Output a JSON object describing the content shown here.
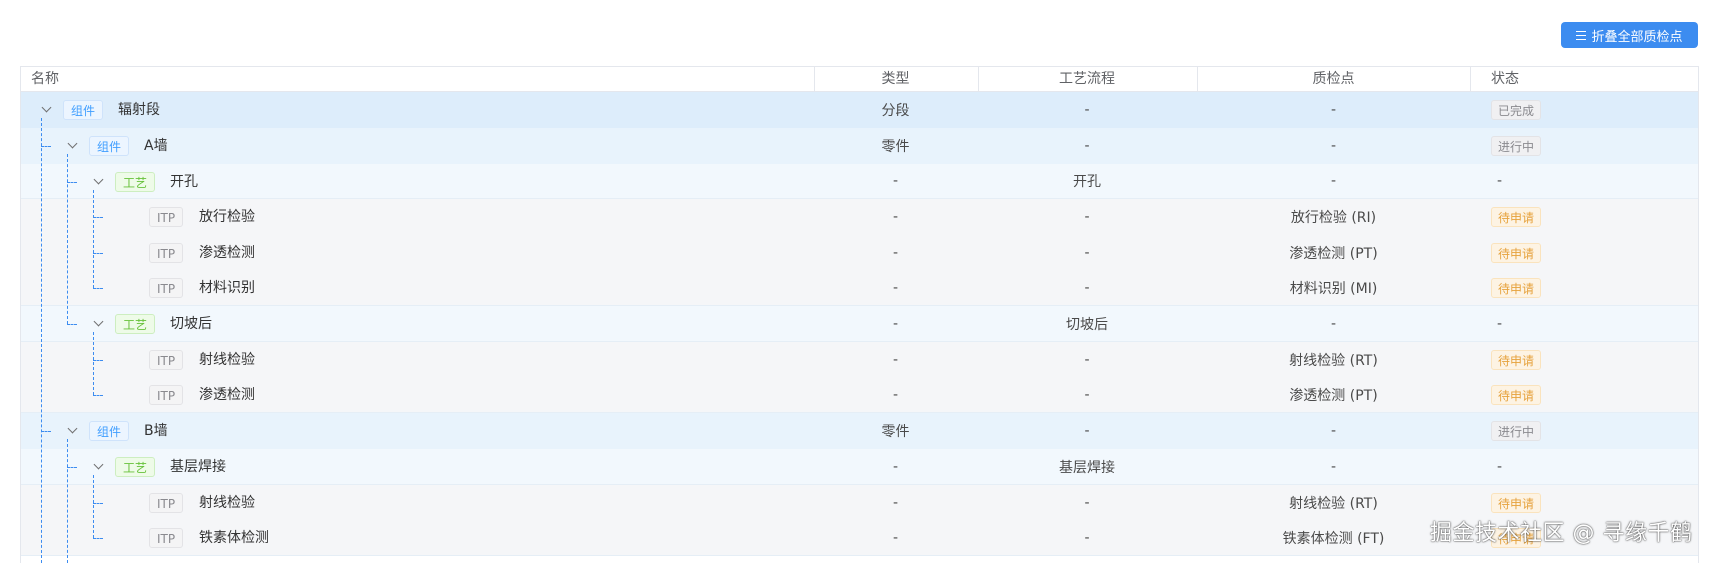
{
  "toolbar": {
    "collapse_label": "折叠全部质检点",
    "collapse_icon": "list-icon"
  },
  "columns": {
    "name": "名称",
    "type": "类型",
    "process": "工艺流程",
    "qc": "质检点",
    "status": "状态"
  },
  "colors": {
    "accent": "#3c8cf0",
    "pending": "#e6a23c",
    "component_tag": "#409eff",
    "process_tag": "#67c23a"
  },
  "rows": [
    {
      "level": 0,
      "tag": "组件",
      "name": "辐射段",
      "type": "分段",
      "process": "-",
      "qc": "-",
      "status": "已完成"
    },
    {
      "level": 1,
      "tag": "组件",
      "name": "A墙",
      "type": "零件",
      "process": "-",
      "qc": "-",
      "status": "进行中"
    },
    {
      "level": 2,
      "tag": "工艺",
      "name": "开孔",
      "type": "-",
      "process": "开孔",
      "qc": "-",
      "status": "-"
    },
    {
      "level": 3,
      "tag": "ITP",
      "name": "放行检验",
      "type": "-",
      "process": "-",
      "qc": "放行检验 (RI)",
      "status": "待申请"
    },
    {
      "level": 3,
      "tag": "ITP",
      "name": "渗透检测",
      "type": "-",
      "process": "-",
      "qc": "渗透检测 (PT)",
      "status": "待申请"
    },
    {
      "level": 3,
      "tag": "ITP",
      "name": "材料识别",
      "type": "-",
      "process": "-",
      "qc": "材料识别 (MI)",
      "status": "待申请"
    },
    {
      "level": 2,
      "tag": "工艺",
      "name": "切坡后",
      "type": "-",
      "process": "切坡后",
      "qc": "-",
      "status": "-"
    },
    {
      "level": 3,
      "tag": "ITP",
      "name": "射线检验",
      "type": "-",
      "process": "-",
      "qc": "射线检验 (RT)",
      "status": "待申请"
    },
    {
      "level": 3,
      "tag": "ITP",
      "name": "渗透检测",
      "type": "-",
      "process": "-",
      "qc": "渗透检测 (PT)",
      "status": "待申请"
    },
    {
      "level": 1,
      "tag": "组件",
      "name": "B墙",
      "type": "零件",
      "process": "-",
      "qc": "-",
      "status": "进行中"
    },
    {
      "level": 2,
      "tag": "工艺",
      "name": "基层焊接",
      "type": "-",
      "process": "基层焊接",
      "qc": "-",
      "status": "-"
    },
    {
      "level": 3,
      "tag": "ITP",
      "name": "射线检验",
      "type": "-",
      "process": "-",
      "qc": "射线检验 (RT)",
      "status": "待申请"
    },
    {
      "level": 3,
      "tag": "ITP",
      "name": "铁素体检测",
      "type": "-",
      "process": "-",
      "qc": "铁素体检测 (FT)",
      "status": "待申请"
    }
  ],
  "watermark": "掘金技术社区 @ 寻缘千鹤"
}
